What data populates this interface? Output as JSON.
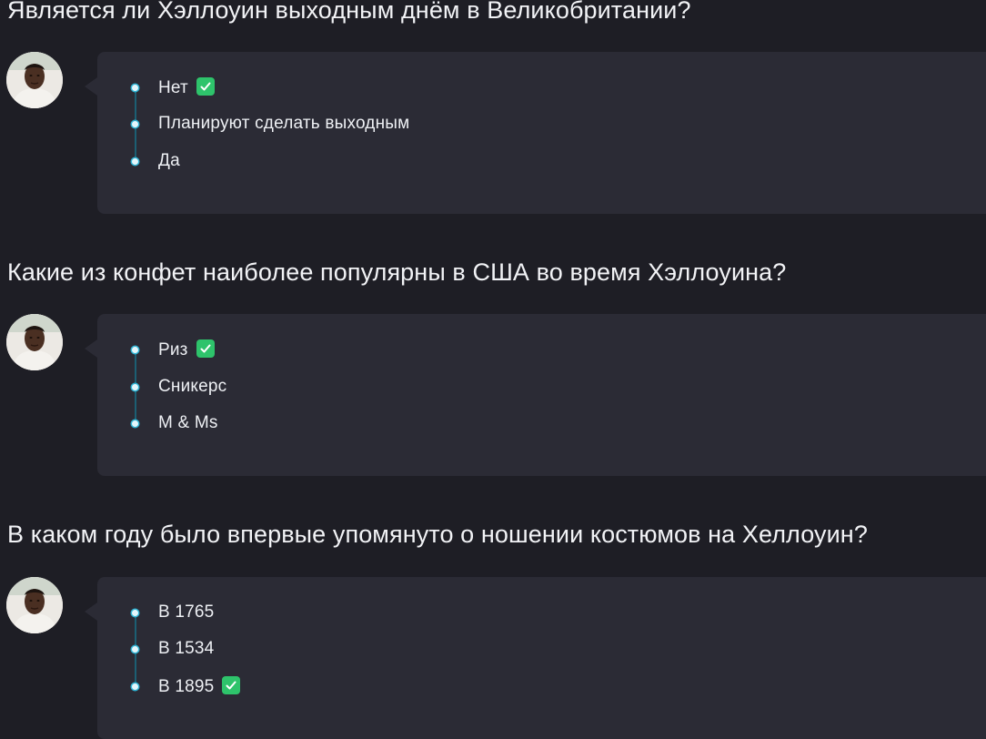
{
  "questions": [
    {
      "text": "Является ли Хэллоуин выходным днём в Великобритании?",
      "options": [
        {
          "label": "Нет",
          "correct": true
        },
        {
          "label": "Планируют сделать выходным",
          "correct": false
        },
        {
          "label": "Да",
          "correct": false
        }
      ]
    },
    {
      "text": "Какие из конфет наиболее популярны в США во время Хэллоуина?",
      "options": [
        {
          "label": "Риз",
          "correct": true
        },
        {
          "label": "Сникерс",
          "correct": false
        },
        {
          "label": "M & Ms",
          "correct": false
        }
      ]
    },
    {
      "text": "В каком году было впервые упомянуто о ношении костюмов на Хеллоуин?",
      "options": [
        {
          "label": "В 1765",
          "correct": false
        },
        {
          "label": "В 1534",
          "correct": false
        },
        {
          "label": "В 1895",
          "correct": true
        }
      ]
    }
  ],
  "icons": {
    "avatar": "avatar-photo",
    "correct": "check-icon",
    "bullet": "timeline-dot"
  },
  "colors": {
    "background": "#1e1e25",
    "bubble": "#2b2b35",
    "timeline": "#2fb3d3",
    "correct": "#2ec36b",
    "text": "#eef0f4"
  }
}
